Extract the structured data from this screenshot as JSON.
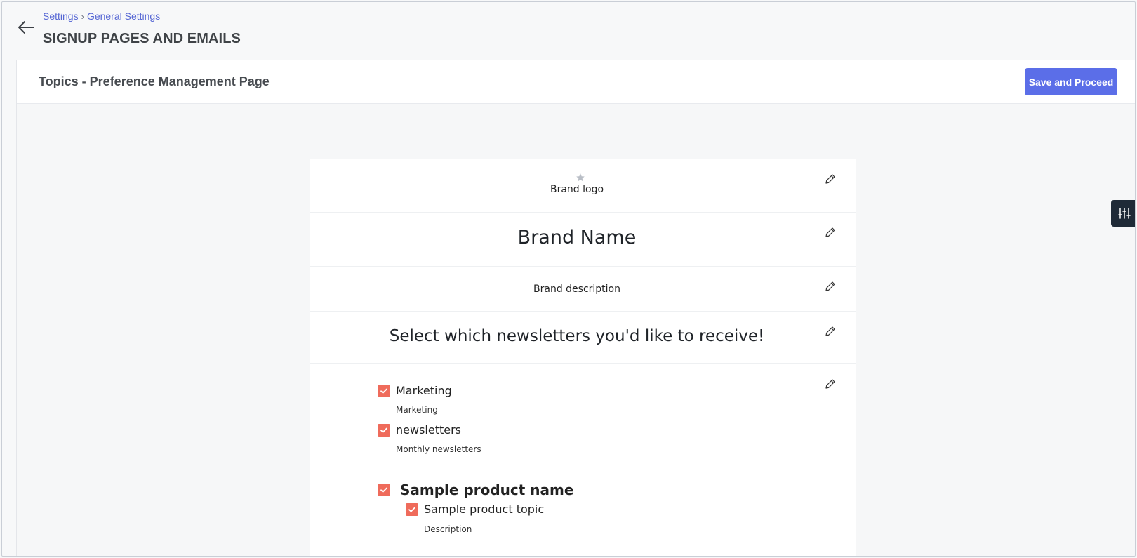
{
  "breadcrumb": {
    "items": [
      "Settings",
      "General Settings"
    ],
    "separator": "›"
  },
  "page": {
    "title": "SIGNUP PAGES AND EMAILS"
  },
  "panel": {
    "title": "Topics - Preference Management Page",
    "save_label": "Save and Proceed"
  },
  "preview": {
    "logo_label": "Brand logo",
    "brand_name": "Brand Name",
    "brand_description": "Brand description",
    "select_heading": "Select which newsletters you'd like to receive!",
    "topics": [
      {
        "label": "Marketing",
        "description": "Marketing",
        "checked": true
      },
      {
        "label": "newsletters",
        "description": "Monthly newsletters",
        "checked": true
      }
    ],
    "product": {
      "name": "Sample product name",
      "checked": true,
      "topic": {
        "label": "Sample product topic",
        "description": "Description",
        "checked": true
      }
    }
  },
  "icons": {
    "back": "arrow-left-icon",
    "edit": "pencil-icon",
    "logo": "star-icon",
    "side_panel": "sliders-icon",
    "checkbox": "checkmark-icon"
  },
  "colors": {
    "accent": "#5b6ee8",
    "link": "#5566d4",
    "checkbox": "#ef6b5b",
    "side_tab": "#1f2a37"
  }
}
